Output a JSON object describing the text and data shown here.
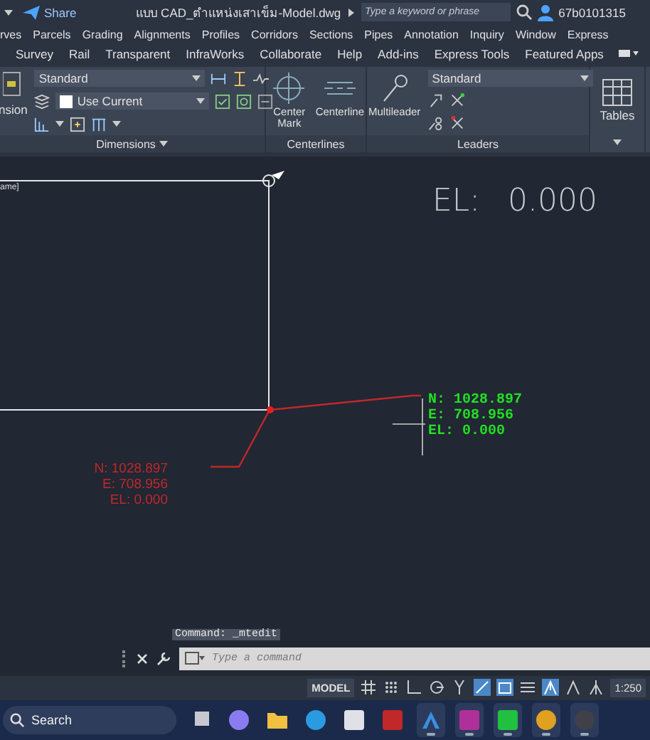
{
  "title_bar": {
    "share": "Share",
    "file_name": "แบบ CAD_ตำแหน่งเสาเข็ม-Model.dwg",
    "search_placeholder": "Type a keyword or phrase",
    "user": "67b0101315"
  },
  "menu": [
    "rves",
    "Parcels",
    "Grading",
    "Alignments",
    "Profiles",
    "Corridors",
    "Sections",
    "Pipes",
    "Annotation",
    "Inquiry",
    "Window",
    "Express"
  ],
  "ribbon_tabs": [
    "Survey",
    "Rail",
    "Transparent",
    "InfraWorks",
    "Collaborate",
    "Help",
    "Add-ins",
    "Express Tools",
    "Featured Apps"
  ],
  "ribbon": {
    "dimensions": {
      "cut_button": "nsion",
      "style": "Standard",
      "layer": "Use Current",
      "label": "Dimensions"
    },
    "centerlines": {
      "buttons": [
        "Center Mark",
        "Centerline"
      ],
      "label": "Centerlines"
    },
    "leaders": {
      "button": "Multileader",
      "style": "Standard",
      "label": "Leaders"
    },
    "tables": {
      "button": "Tables"
    }
  },
  "canvas": {
    "viewport_label": "ame]",
    "elevation_label": "EL:",
    "elevation_value": "0.000",
    "red_label": [
      "N:  1028.897",
      "E:  708.956",
      "EL:  0.000"
    ],
    "green_label": [
      "N: 1028.897",
      "E: 708.956",
      "EL: 0.000"
    ]
  },
  "command": {
    "history": "Command:  _mtedit",
    "placeholder": "Type a command"
  },
  "status_bar": {
    "model": "MODEL",
    "scale": "1:250"
  },
  "taskbar": {
    "search_placeholder": "Search",
    "apps": [
      {
        "kind": "task-view",
        "active": false
      },
      {
        "kind": "copilot",
        "active": false
      },
      {
        "kind": "folder",
        "active": false
      },
      {
        "kind": "browser",
        "active": false
      },
      {
        "kind": "store",
        "active": false
      },
      {
        "kind": "cad",
        "active": false
      },
      {
        "kind": "civil-a",
        "active": true
      },
      {
        "kind": "civil-c",
        "active": true
      },
      {
        "kind": "chat",
        "active": true
      },
      {
        "kind": "chrome",
        "active": true
      },
      {
        "kind": "recorder",
        "active": true
      }
    ]
  }
}
